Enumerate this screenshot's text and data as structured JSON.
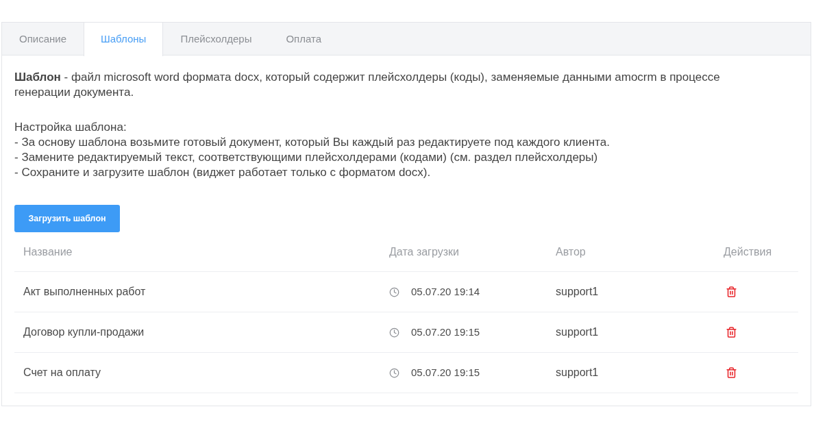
{
  "tabs": [
    {
      "label": "Описание",
      "selected": false
    },
    {
      "label": "Шаблоны",
      "selected": true
    },
    {
      "label": "Плейсхолдеры",
      "selected": false
    },
    {
      "label": "Оплата",
      "selected": false
    }
  ],
  "description": {
    "intro": "**Шаблон** - файл microsoft word формата docx, который содержит плейсхолдеры (коды), заменяемые данными amocrm в процессе генерации документа.",
    "setup_title": "Настройка шаблона:",
    "steps": [
      "- За основу шаблона возьмите готовый документ, который Вы каждый раз редактируете под каждого клиента.",
      "- Замените редактируемый текст, соответствующими плейсхолдерами (кодами) (см. раздел плейсхолдеры)",
      "- Сохраните и загрузите шаблон (виджет работает только с форматом docx)."
    ]
  },
  "upload_button": "Загрузить шаблон",
  "table": {
    "columns": [
      "Название",
      "Дата загрузки",
      "Автор",
      "Действия"
    ],
    "rows": [
      {
        "name": "Акт выполненных работ",
        "uploaded": "05.07.20 19:14",
        "author": "support1"
      },
      {
        "name": "Договор купли-продажи",
        "uploaded": "05.07.20 19:15",
        "author": "support1"
      },
      {
        "name": "Счет на оплату",
        "uploaded": "05.07.20 19:15",
        "author": "support1"
      }
    ]
  }
}
